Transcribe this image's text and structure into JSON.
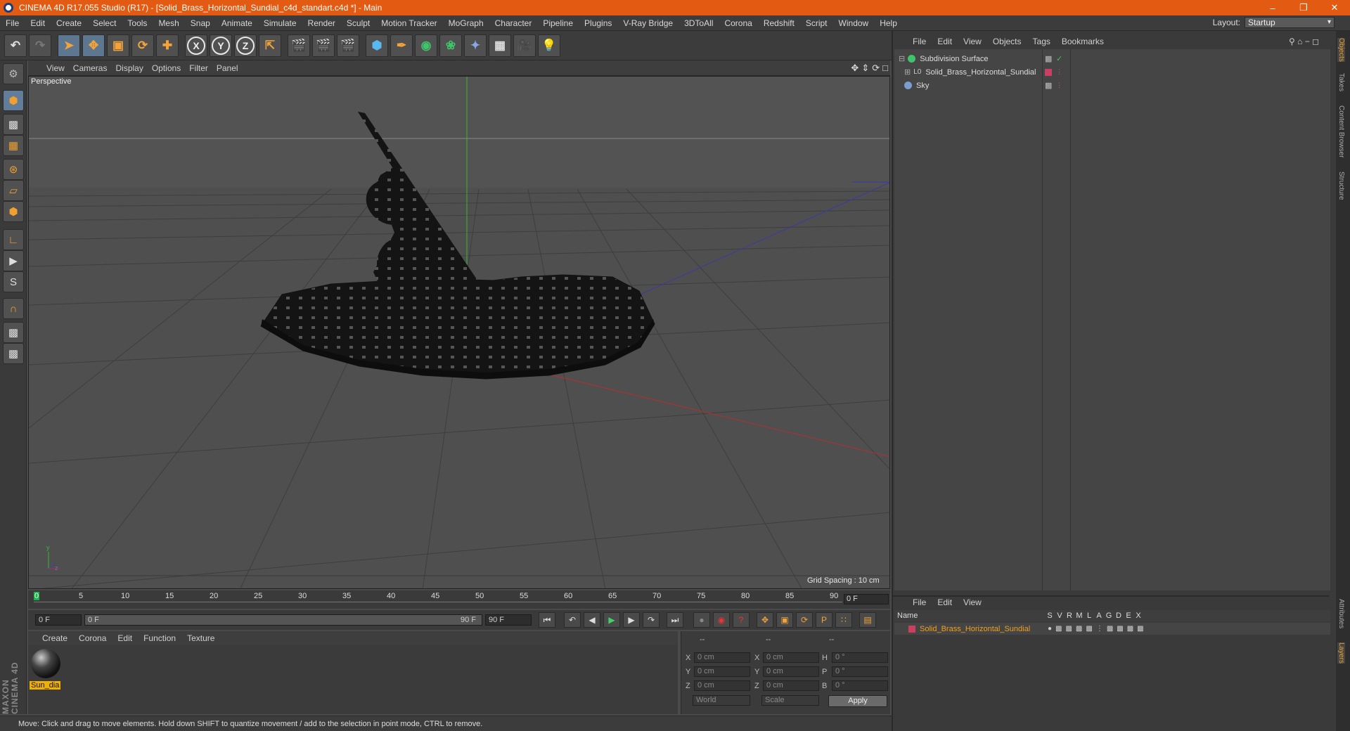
{
  "window": {
    "title": "CINEMA 4D R17.055 Studio (R17) - [Solid_Brass_Horizontal_Sundial_c4d_standart.c4d *] - Main",
    "minimize": "–",
    "restore": "❐",
    "close": "✕"
  },
  "menu": [
    "File",
    "Edit",
    "Create",
    "Select",
    "Tools",
    "Mesh",
    "Snap",
    "Animate",
    "Simulate",
    "Render",
    "Sculpt",
    "Motion Tracker",
    "MoGraph",
    "Character",
    "Pipeline",
    "Plugins",
    "V-Ray Bridge",
    "3DToAll",
    "Corona",
    "Redshift",
    "Script",
    "Window",
    "Help"
  ],
  "layout": {
    "label": "Layout:",
    "value": "Startup"
  },
  "toolbar": {
    "x": "X",
    "y": "Y",
    "z": "Z"
  },
  "viewport": {
    "menu": [
      "View",
      "Cameras",
      "Display",
      "Options",
      "Filter",
      "Panel"
    ],
    "label": "Perspective",
    "grid_spacing": "Grid Spacing : 10 cm",
    "axis_y": "y",
    "axis_z": "z"
  },
  "timeline": {
    "ticks": [
      "0",
      "5",
      "10",
      "15",
      "20",
      "25",
      "30",
      "35",
      "40",
      "45",
      "50",
      "55",
      "60",
      "65",
      "70",
      "75",
      "80",
      "85",
      "90"
    ],
    "current": "0 F",
    "start": "0 F",
    "range_start": "0 F",
    "range_end": "90 F",
    "end": "90 F"
  },
  "materials": {
    "menu": [
      "Create",
      "Corona",
      "Edit",
      "Function",
      "Texture"
    ],
    "items": [
      {
        "name": "Sun_dia"
      }
    ]
  },
  "coordinates": {
    "headers": [
      "--",
      "--",
      "--"
    ],
    "rows": [
      {
        "a": "X",
        "av": "0 cm",
        "b": "X",
        "bv": "0 cm",
        "c": "H",
        "cv": "0 °"
      },
      {
        "a": "Y",
        "av": "0 cm",
        "b": "Y",
        "bv": "0 cm",
        "c": "P",
        "cv": "0 °"
      },
      {
        "a": "Z",
        "av": "0 cm",
        "b": "Z",
        "bv": "0 cm",
        "c": "B",
        "cv": "0 °"
      }
    ],
    "mode1": "World",
    "mode2": "Scale",
    "apply": "Apply"
  },
  "status": "Move: Click and drag to move elements. Hold down SHIFT to quantize movement / add to the selection in point mode, CTRL to remove.",
  "objects": {
    "menu": [
      "File",
      "Edit",
      "View",
      "Objects",
      "Tags",
      "Bookmarks"
    ],
    "items": [
      {
        "name": "Subdivision Surface",
        "color": "#3fc46b"
      },
      {
        "name": "Solid_Brass_Horizontal_Sundial",
        "color": "#cccccc"
      },
      {
        "name": "Sky",
        "color": "#7a9ed0"
      }
    ]
  },
  "layers": {
    "menu": [
      "File",
      "Edit",
      "View"
    ],
    "header_name": "Name",
    "columns": [
      "S",
      "V",
      "R",
      "M",
      "L",
      "A",
      "G",
      "D",
      "E",
      "X"
    ],
    "row": "Solid_Brass_Horizontal_Sundial"
  },
  "sidetabs": [
    "Objects",
    "Takes",
    "Content Browser",
    "Structure",
    "Attributes",
    "Layers"
  ],
  "brand": "MAXON CINEMA 4D"
}
